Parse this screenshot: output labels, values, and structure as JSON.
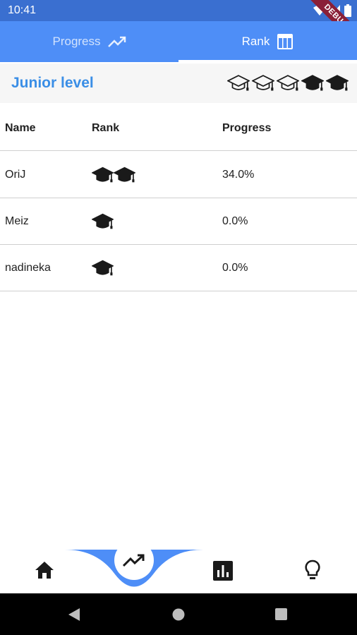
{
  "status": {
    "time": "10:41",
    "debug_label": "DEBUG"
  },
  "tabs": [
    {
      "label": "Progress",
      "icon": "trending-up-icon"
    },
    {
      "label": "Rank",
      "icon": "table-chart-icon"
    }
  ],
  "level": {
    "title": "Junior level",
    "caps_filled": 2,
    "caps_total": 5
  },
  "table": {
    "headers": {
      "name": "Name",
      "rank": "Rank",
      "progress": "Progress"
    },
    "rows": [
      {
        "name": "OriJ",
        "rank_caps": 2,
        "progress": "34.0%"
      },
      {
        "name": "Meiz",
        "rank_caps": 1,
        "progress": "0.0%"
      },
      {
        "name": "nadineka",
        "rank_caps": 1,
        "progress": "0.0%"
      }
    ]
  },
  "colors": {
    "primary": "#4e8ef7",
    "level_title": "#3a8ee6",
    "status_bar": "#3a6fd0",
    "debug": "#8a2038"
  },
  "bottom_nav": [
    {
      "icon": "home-icon"
    },
    {
      "icon": "trending-up-icon"
    },
    {
      "icon": "bar-chart-icon"
    },
    {
      "icon": "lightbulb-icon"
    }
  ]
}
